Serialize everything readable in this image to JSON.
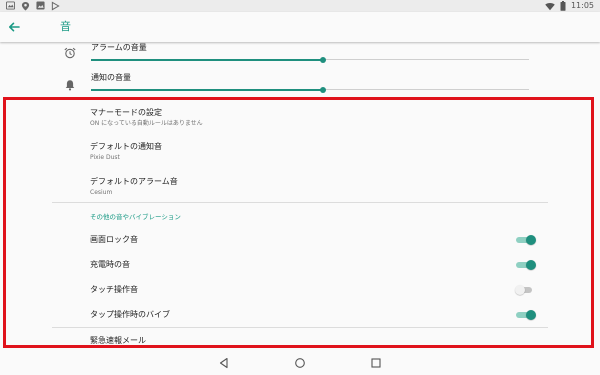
{
  "status_bar": {
    "time": "11:05",
    "left_icons": [
      "image-icon",
      "location-icon",
      "photo-icon",
      "play-store-icon"
    ],
    "right_icons": [
      "wifi-icon",
      "battery-icon"
    ]
  },
  "app_bar": {
    "title": "音",
    "back_icon": "arrow-back-icon"
  },
  "volume": [
    {
      "label": "アラームの音量",
      "icon": "alarm-clock-icon",
      "level": 0.53
    },
    {
      "label": "通知の音量",
      "icon": "bell-icon",
      "level": 0.53
    }
  ],
  "preferences": [
    {
      "title": "マナーモードの設定",
      "summary": "ON になっている自動ルールはありません"
    },
    {
      "title": "デフォルトの通知音",
      "summary": "Pixie Dust"
    },
    {
      "title": "デフォルトのアラーム音",
      "summary": "Cesium"
    }
  ],
  "other_section": {
    "header": "その他の音やバイブレーション",
    "toggles": [
      {
        "label": "画面ロック音",
        "on": true
      },
      {
        "label": "充電時の音",
        "on": true
      },
      {
        "label": "タッチ操作音",
        "on": false
      },
      {
        "label": "タップ操作時のバイブ",
        "on": true
      }
    ]
  },
  "emergency": {
    "title": "緊急速報メール"
  },
  "nav_bar": {
    "icons": [
      "back-triangle-icon",
      "home-circle-icon",
      "recents-square-icon"
    ]
  },
  "colors": {
    "accent": "#1a9a85",
    "switch_on": "#1f8f7e",
    "highlight": "#e0121b"
  }
}
